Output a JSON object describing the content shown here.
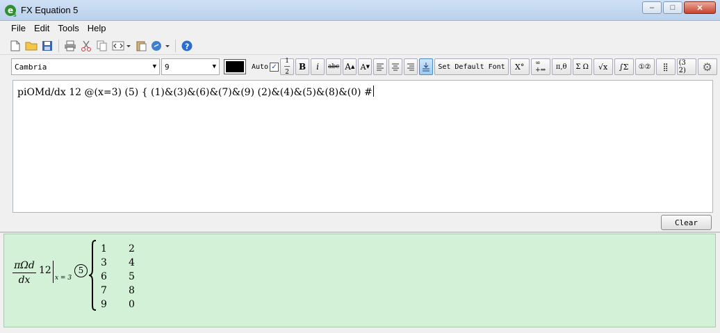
{
  "window": {
    "title": "FX Equation 5",
    "app_icon": "fx-equation-icon",
    "controls": {
      "minimize": "–",
      "maximize": "□",
      "close": "✕"
    }
  },
  "menu": [
    "File",
    "Edit",
    "Tools",
    "Help"
  ],
  "toolbar1": [
    "new-file-icon",
    "open-folder-icon",
    "save-icon",
    "print-icon",
    "cut-icon",
    "copy-icon",
    "code-icon",
    "paste-icon",
    "link-icon",
    "help-icon"
  ],
  "format_toolbar": {
    "font": "Cambria",
    "size": "9",
    "color": "#000000",
    "auto_label": "Auto",
    "auto_checked": "✓",
    "set_default_font": "Set Default Font"
  },
  "editor": {
    "text": "piOMd/dx 12 @(x=3) (5) { (1)&(3)&(6)&(7)&(9) (2)&(4)&(5)&(8)&(0) #"
  },
  "clear_button": "Clear",
  "preview": {
    "fraction_numerator": "πΩd",
    "fraction_denominator": "dx",
    "coefficient": "12",
    "subscript": "x = 3",
    "circled": "5",
    "matrix": [
      [
        "1",
        "2"
      ],
      [
        "3",
        "4"
      ],
      [
        "6",
        "5"
      ],
      [
        "7",
        "8"
      ],
      [
        "9",
        "0"
      ]
    ]
  }
}
